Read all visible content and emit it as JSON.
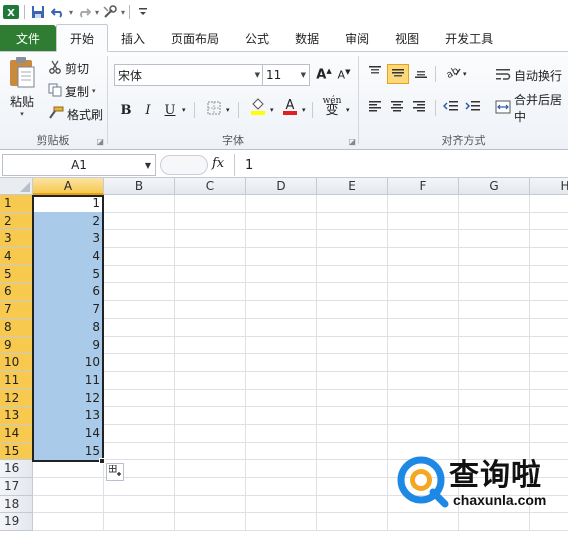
{
  "quick_access": {
    "icons": [
      "excel-icon",
      "save-icon",
      "undo-icon",
      "redo-icon",
      "customize-icon"
    ]
  },
  "tabs": [
    {
      "label": "文件",
      "name": "tab-file"
    },
    {
      "label": "开始",
      "name": "tab-home",
      "active": true
    },
    {
      "label": "插入",
      "name": "tab-insert"
    },
    {
      "label": "页面布局",
      "name": "tab-page-layout"
    },
    {
      "label": "公式",
      "name": "tab-formulas"
    },
    {
      "label": "数据",
      "name": "tab-data"
    },
    {
      "label": "审阅",
      "name": "tab-review"
    },
    {
      "label": "视图",
      "name": "tab-view"
    },
    {
      "label": "开发工具",
      "name": "tab-developer"
    }
  ],
  "ribbon": {
    "clipboard": {
      "paste": "粘贴",
      "cut": "剪切",
      "copy": "复制",
      "format_painter": "格式刷",
      "group_label": "剪贴板"
    },
    "font": {
      "font_name": "宋体",
      "font_size": "11",
      "bold": "B",
      "italic": "I",
      "underline": "U",
      "group_label": "字体",
      "fill_color": "#ffff00",
      "font_color": "#e02020",
      "wen": "wén",
      "wen_char": "变"
    },
    "alignment": {
      "wrap_text": "自动换行",
      "merge_center": "合并后居中",
      "group_label": "对齐方式"
    }
  },
  "formula_bar": {
    "name_box": "A1",
    "fx": "fx",
    "content": "1"
  },
  "sheet": {
    "columns": [
      "A",
      "B",
      "C",
      "D",
      "E",
      "F",
      "G",
      "H"
    ],
    "rows": [
      "1",
      "2",
      "3",
      "4",
      "5",
      "6",
      "7",
      "8",
      "9",
      "10",
      "11",
      "12",
      "13",
      "14",
      "15",
      "16",
      "17",
      "18",
      "19"
    ],
    "colA_values": [
      "1",
      "2",
      "3",
      "4",
      "5",
      "6",
      "7",
      "8",
      "9",
      "10",
      "11",
      "12",
      "13",
      "14",
      "15"
    ]
  },
  "watermark": {
    "text": "查询啦",
    "url": "chaxunla.com",
    "accent": "#1e88e5",
    "accent2": "#f5a623"
  },
  "colors": {
    "file_tab": "#2e7d32",
    "selection": "#a9cbe9",
    "header_selected": "#f7c94e"
  }
}
